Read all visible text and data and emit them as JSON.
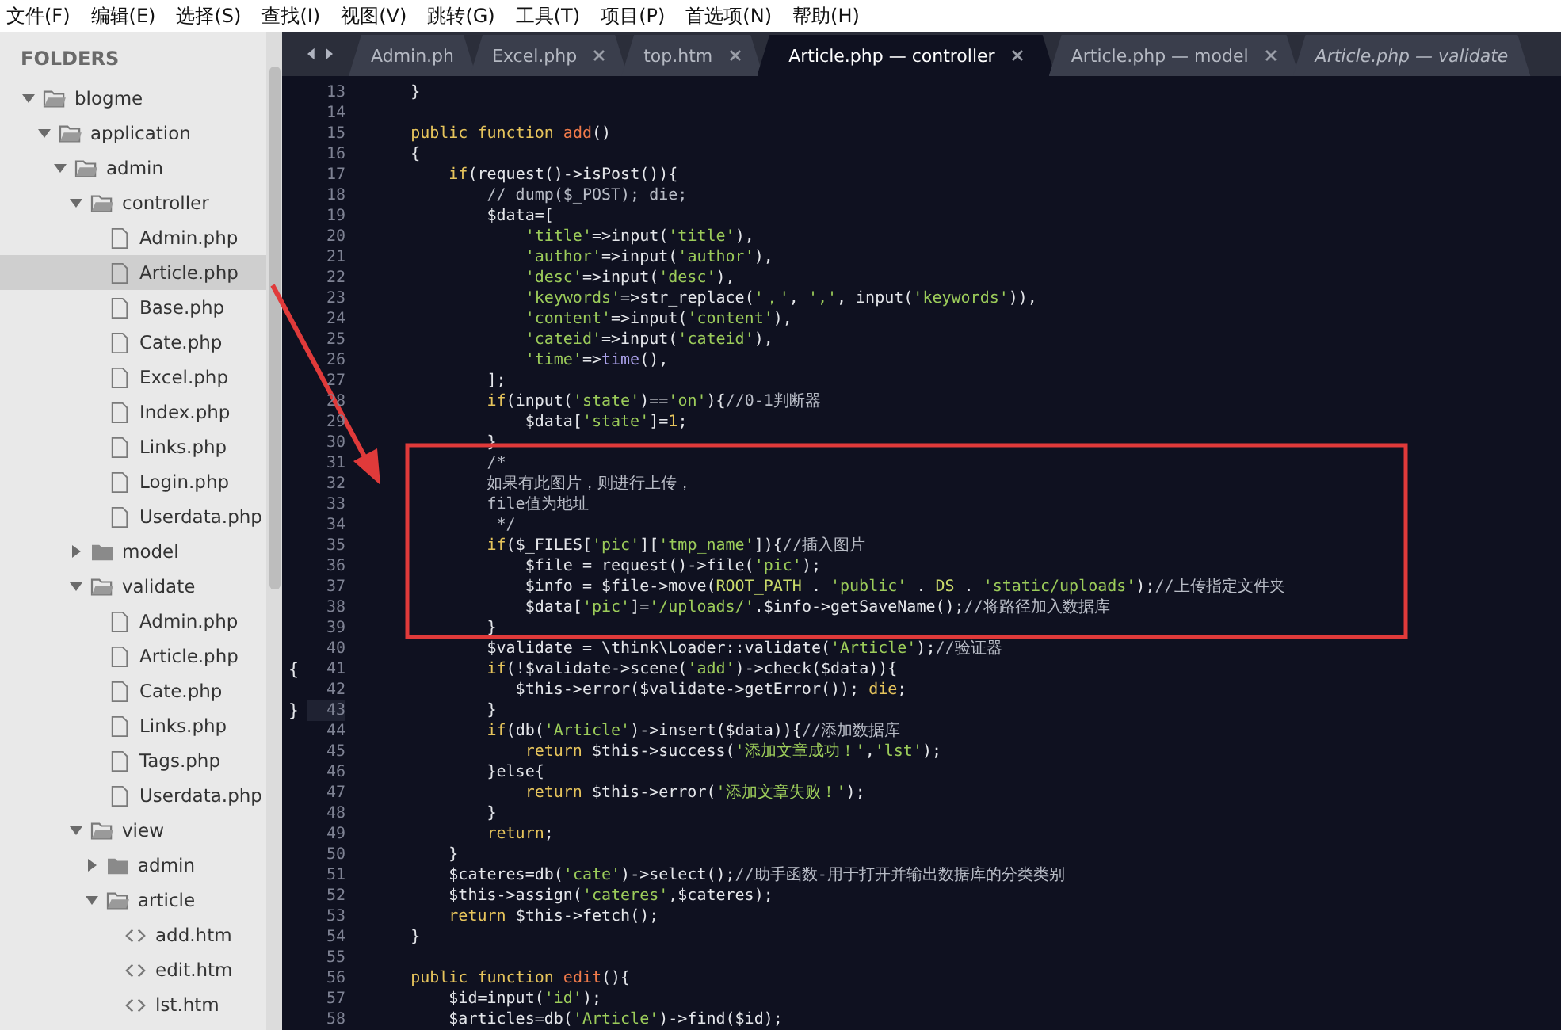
{
  "menu": [
    "文件(F)",
    "编辑(E)",
    "选择(S)",
    "查找(I)",
    "视图(V)",
    "跳转(G)",
    "工具(T)",
    "项目(P)",
    "首选项(N)",
    "帮助(H)"
  ],
  "sidebar": {
    "title": "FOLDERS",
    "tree": [
      {
        "name": "blogme",
        "kind": "folder",
        "expanded": true,
        "selected": false,
        "children": [
          {
            "name": "application",
            "kind": "folder",
            "expanded": true,
            "selected": false,
            "children": [
              {
                "name": "admin",
                "kind": "folder",
                "expanded": true,
                "selected": false,
                "children": [
                  {
                    "name": "controller",
                    "kind": "folder",
                    "expanded": true,
                    "selected": false,
                    "children": [
                      {
                        "name": "Admin.php",
                        "kind": "file",
                        "selected": false
                      },
                      {
                        "name": "Article.php",
                        "kind": "file",
                        "selected": true
                      },
                      {
                        "name": "Base.php",
                        "kind": "file",
                        "selected": false
                      },
                      {
                        "name": "Cate.php",
                        "kind": "file",
                        "selected": false
                      },
                      {
                        "name": "Excel.php",
                        "kind": "file",
                        "selected": false
                      },
                      {
                        "name": "Index.php",
                        "kind": "file",
                        "selected": false
                      },
                      {
                        "name": "Links.php",
                        "kind": "file",
                        "selected": false
                      },
                      {
                        "name": "Login.php",
                        "kind": "file",
                        "selected": false
                      },
                      {
                        "name": "Userdata.php",
                        "kind": "file",
                        "selected": false
                      }
                    ]
                  },
                  {
                    "name": "model",
                    "kind": "folder",
                    "expanded": false,
                    "selected": false
                  },
                  {
                    "name": "validate",
                    "kind": "folder",
                    "expanded": true,
                    "selected": false,
                    "children": [
                      {
                        "name": "Admin.php",
                        "kind": "file",
                        "selected": false
                      },
                      {
                        "name": "Article.php",
                        "kind": "file",
                        "selected": false
                      },
                      {
                        "name": "Cate.php",
                        "kind": "file",
                        "selected": false
                      },
                      {
                        "name": "Links.php",
                        "kind": "file",
                        "selected": false
                      },
                      {
                        "name": "Tags.php",
                        "kind": "file",
                        "selected": false
                      },
                      {
                        "name": "Userdata.php",
                        "kind": "file",
                        "selected": false
                      }
                    ]
                  },
                  {
                    "name": "view",
                    "kind": "folder",
                    "expanded": true,
                    "selected": false,
                    "children": [
                      {
                        "name": "admin",
                        "kind": "folder",
                        "expanded": false,
                        "selected": false
                      },
                      {
                        "name": "article",
                        "kind": "folder",
                        "expanded": true,
                        "selected": false,
                        "children": [
                          {
                            "name": "add.htm",
                            "kind": "markup",
                            "selected": false
                          },
                          {
                            "name": "edit.htm",
                            "kind": "markup",
                            "selected": false
                          },
                          {
                            "name": "lst.htm",
                            "kind": "markup",
                            "selected": false
                          }
                        ]
                      }
                    ]
                  }
                ]
              }
            ]
          }
        ]
      }
    ]
  },
  "tabs": [
    {
      "label": "Admin.ph",
      "selected": false,
      "closable": false,
      "preview": false
    },
    {
      "label": "Excel.php",
      "selected": false,
      "closable": true,
      "preview": false
    },
    {
      "label": "top.htm",
      "selected": false,
      "closable": true,
      "preview": false
    },
    {
      "label": "Article.php — controller",
      "selected": true,
      "closable": true,
      "preview": false
    },
    {
      "label": "Article.php — model",
      "selected": false,
      "closable": true,
      "preview": false
    },
    {
      "label": "Article.php — validate",
      "selected": false,
      "closable": false,
      "preview": true
    }
  ],
  "code": [
    {
      "n": "13",
      "tokens": [
        {
          "text": "    }",
          "kind": "plain"
        }
      ]
    },
    {
      "n": "14"
    },
    {
      "n": "15",
      "tokens": [
        {
          "text": "    public function ",
          "kind": "keyword"
        },
        {
          "text": "add",
          "kind": "function"
        },
        {
          "text": "()",
          "kind": "plain"
        }
      ]
    },
    {
      "n": "16",
      "tokens": [
        {
          "text": "    {",
          "kind": "plain"
        }
      ]
    },
    {
      "n": "17",
      "tokens": [
        {
          "text": "        if",
          "kind": "keyword"
        },
        {
          "text": "(request()->isPost()){",
          "kind": "plain"
        }
      ]
    },
    {
      "n": "18",
      "tokens": [
        {
          "text": "            // dump($_POST); die;",
          "kind": "comment"
        }
      ]
    },
    {
      "n": "19",
      "tokens": [
        {
          "text": "            $data=[",
          "kind": "plain"
        }
      ]
    },
    {
      "n": "20",
      "tokens": [
        {
          "text": "                'title'",
          "kind": "string"
        },
        {
          "text": "=>input(",
          "kind": "plain"
        },
        {
          "text": "'title'",
          "kind": "string"
        },
        {
          "text": "),",
          "kind": "plain"
        }
      ]
    },
    {
      "n": "21",
      "tokens": [
        {
          "text": "                'author'",
          "kind": "string"
        },
        {
          "text": "=>input(",
          "kind": "plain"
        },
        {
          "text": "'author'",
          "kind": "string"
        },
        {
          "text": "),",
          "kind": "plain"
        }
      ]
    },
    {
      "n": "22",
      "tokens": [
        {
          "text": "                'desc'",
          "kind": "string"
        },
        {
          "text": "=>input(",
          "kind": "plain"
        },
        {
          "text": "'desc'",
          "kind": "string"
        },
        {
          "text": "),",
          "kind": "plain"
        }
      ]
    },
    {
      "n": "23",
      "tokens": [
        {
          "text": "                'keywords'",
          "kind": "string"
        },
        {
          "text": "=>str_replace(",
          "kind": "plain"
        },
        {
          "text": "'，'",
          "kind": "string"
        },
        {
          "text": ", ",
          "kind": "plain"
        },
        {
          "text": "','",
          "kind": "string"
        },
        {
          "text": ", input(",
          "kind": "plain"
        },
        {
          "text": "'keywords'",
          "kind": "string"
        },
        {
          "text": ")),",
          "kind": "plain"
        }
      ]
    },
    {
      "n": "24",
      "tokens": [
        {
          "text": "                'content'",
          "kind": "string"
        },
        {
          "text": "=>input(",
          "kind": "plain"
        },
        {
          "text": "'content'",
          "kind": "string"
        },
        {
          "text": "),",
          "kind": "plain"
        }
      ]
    },
    {
      "n": "25",
      "tokens": [
        {
          "text": "                'cateid'",
          "kind": "string"
        },
        {
          "text": "=>input(",
          "kind": "plain"
        },
        {
          "text": "'cateid'",
          "kind": "string"
        },
        {
          "text": "),",
          "kind": "plain"
        }
      ]
    },
    {
      "n": "26",
      "tokens": [
        {
          "text": "                'time'",
          "kind": "string"
        },
        {
          "text": "=>",
          "kind": "plain"
        },
        {
          "text": "time",
          "kind": "builtin"
        },
        {
          "text": "(),",
          "kind": "plain"
        }
      ]
    },
    {
      "n": "27",
      "tokens": [
        {
          "text": "            ];",
          "kind": "plain"
        }
      ]
    },
    {
      "n": "28",
      "tokens": [
        {
          "text": "            if",
          "kind": "keyword"
        },
        {
          "text": "(input(",
          "kind": "plain"
        },
        {
          "text": "'state'",
          "kind": "string"
        },
        {
          "text": ")==",
          "kind": "plain"
        },
        {
          "text": "'on'",
          "kind": "string"
        },
        {
          "text": "){",
          "kind": "plain"
        },
        {
          "text": "//0-1判断器",
          "kind": "comment"
        }
      ]
    },
    {
      "n": "29",
      "tokens": [
        {
          "text": "                $data[",
          "kind": "plain"
        },
        {
          "text": "'state'",
          "kind": "string"
        },
        {
          "text": "]=",
          "kind": "plain"
        },
        {
          "text": "1",
          "kind": "number"
        },
        {
          "text": ";",
          "kind": "plain"
        }
      ]
    },
    {
      "n": "30",
      "tokens": [
        {
          "text": "            }",
          "kind": "plain"
        }
      ]
    },
    {
      "n": "31",
      "tokens": [
        {
          "text": "            /*",
          "kind": "comment"
        }
      ]
    },
    {
      "n": "32",
      "tokens": [
        {
          "text": "            如果有此图片，则进行上传，",
          "kind": "comment"
        }
      ]
    },
    {
      "n": "33",
      "tokens": [
        {
          "text": "            file值为地址",
          "kind": "comment"
        }
      ]
    },
    {
      "n": "34",
      "tokens": [
        {
          "text": "             */",
          "kind": "comment"
        }
      ]
    },
    {
      "n": "35",
      "tokens": [
        {
          "text": "            if",
          "kind": "keyword"
        },
        {
          "text": "($_FILES[",
          "kind": "plain"
        },
        {
          "text": "'pic'",
          "kind": "string"
        },
        {
          "text": "][",
          "kind": "plain"
        },
        {
          "text": "'tmp_name'",
          "kind": "string"
        },
        {
          "text": "]){",
          "kind": "plain"
        },
        {
          "text": "//插入图片",
          "kind": "comment"
        }
      ]
    },
    {
      "n": "36",
      "tokens": [
        {
          "text": "                $file = request()->file(",
          "kind": "plain"
        },
        {
          "text": "'pic'",
          "kind": "string"
        },
        {
          "text": ");",
          "kind": "plain"
        }
      ]
    },
    {
      "n": "37",
      "tokens": [
        {
          "text": "                $info = $file->move(",
          "kind": "plain"
        },
        {
          "text": "ROOT_PATH",
          "kind": "constant"
        },
        {
          "text": " . ",
          "kind": "plain"
        },
        {
          "text": "'public'",
          "kind": "string"
        },
        {
          "text": " . ",
          "kind": "plain"
        },
        {
          "text": "DS",
          "kind": "constant"
        },
        {
          "text": " . ",
          "kind": "plain"
        },
        {
          "text": "'static/uploads'",
          "kind": "string"
        },
        {
          "text": ");",
          "kind": "plain"
        },
        {
          "text": "//上传指定文件夹",
          "kind": "comment"
        }
      ]
    },
    {
      "n": "38",
      "tokens": [
        {
          "text": "                $data[",
          "kind": "plain"
        },
        {
          "text": "'pic'",
          "kind": "string"
        },
        {
          "text": "]=",
          "kind": "plain"
        },
        {
          "text": "'/uploads/'",
          "kind": "string"
        },
        {
          "text": ".$info->getSaveName();",
          "kind": "plain"
        },
        {
          "text": "//将路径加入数据库",
          "kind": "comment"
        }
      ]
    },
    {
      "n": "39",
      "tokens": [
        {
          "text": "            }",
          "kind": "plain"
        }
      ]
    },
    {
      "n": "40",
      "tokens": [
        {
          "text": "            $validate = \\think\\Loader::validate(",
          "kind": "plain"
        },
        {
          "text": "'Article'",
          "kind": "string"
        },
        {
          "text": ");",
          "kind": "plain"
        },
        {
          "text": "//验证器",
          "kind": "comment"
        }
      ]
    },
    {
      "n": "41",
      "gutter": "{",
      "tokens": [
        {
          "text": "            if",
          "kind": "keyword"
        },
        {
          "text": "(!$validate->scene(",
          "kind": "plain"
        },
        {
          "text": "'add'",
          "kind": "string"
        },
        {
          "text": ")->check($data)){",
          "kind": "plain"
        }
      ]
    },
    {
      "n": "42",
      "tokens": [
        {
          "text": "               $this->error($validate->getError()); ",
          "kind": "plain"
        },
        {
          "text": "die",
          "kind": "keyword"
        },
        {
          "text": ";",
          "kind": "plain"
        }
      ]
    },
    {
      "n": "43",
      "gutter": "}",
      "current": true,
      "tokens": [
        {
          "text": "            }",
          "kind": "plain"
        }
      ]
    },
    {
      "n": "44",
      "tokens": [
        {
          "text": "            if",
          "kind": "keyword"
        },
        {
          "text": "(db(",
          "kind": "plain"
        },
        {
          "text": "'Article'",
          "kind": "string"
        },
        {
          "text": ")->insert($data)){",
          "kind": "plain"
        },
        {
          "text": "//添加数据库",
          "kind": "comment"
        }
      ]
    },
    {
      "n": "45",
      "tokens": [
        {
          "text": "                return",
          "kind": "keyword"
        },
        {
          "text": " $this->success(",
          "kind": "plain"
        },
        {
          "text": "'添加文章成功！'",
          "kind": "string"
        },
        {
          "text": ",",
          "kind": "plain"
        },
        {
          "text": "'lst'",
          "kind": "string"
        },
        {
          "text": ");",
          "kind": "plain"
        }
      ]
    },
    {
      "n": "46",
      "tokens": [
        {
          "text": "            }else{",
          "kind": "plain"
        }
      ]
    },
    {
      "n": "47",
      "tokens": [
        {
          "text": "                return",
          "kind": "keyword"
        },
        {
          "text": " $this->error(",
          "kind": "plain"
        },
        {
          "text": "'添加文章失败！'",
          "kind": "string"
        },
        {
          "text": ");",
          "kind": "plain"
        }
      ]
    },
    {
      "n": "48",
      "tokens": [
        {
          "text": "            }",
          "kind": "plain"
        }
      ]
    },
    {
      "n": "49",
      "tokens": [
        {
          "text": "            return",
          "kind": "keyword"
        },
        {
          "text": ";",
          "kind": "plain"
        }
      ]
    },
    {
      "n": "50",
      "tokens": [
        {
          "text": "        }",
          "kind": "plain"
        }
      ]
    },
    {
      "n": "51",
      "tokens": [
        {
          "text": "        $cateres=db(",
          "kind": "plain"
        },
        {
          "text": "'cate'",
          "kind": "string"
        },
        {
          "text": ")->select();",
          "kind": "plain"
        },
        {
          "text": "//助手函数-用于打开并输出数据库的分类类别",
          "kind": "comment"
        }
      ]
    },
    {
      "n": "52",
      "tokens": [
        {
          "text": "        $this->assign(",
          "kind": "plain"
        },
        {
          "text": "'cateres'",
          "kind": "string"
        },
        {
          "text": ",$cateres);",
          "kind": "plain"
        }
      ]
    },
    {
      "n": "53",
      "tokens": [
        {
          "text": "        return",
          "kind": "keyword"
        },
        {
          "text": " $this->fetch();",
          "kind": "plain"
        }
      ]
    },
    {
      "n": "54",
      "tokens": [
        {
          "text": "    }",
          "kind": "plain"
        }
      ]
    },
    {
      "n": "55"
    },
    {
      "n": "56",
      "tokens": [
        {
          "text": "    public function ",
          "kind": "keyword"
        },
        {
          "text": "edit",
          "kind": "function"
        },
        {
          "text": "(){",
          "kind": "plain"
        }
      ]
    },
    {
      "n": "57",
      "tokens": [
        {
          "text": "        $id=input(",
          "kind": "plain"
        },
        {
          "text": "'id'",
          "kind": "string"
        },
        {
          "text": ");",
          "kind": "plain"
        }
      ]
    },
    {
      "n": "58",
      "tokens": [
        {
          "text": "        $articles=db(",
          "kind": "plain"
        },
        {
          "text": "'Article'",
          "kind": "string"
        },
        {
          "text": ")->find($id);",
          "kind": "plain"
        }
      ]
    }
  ]
}
